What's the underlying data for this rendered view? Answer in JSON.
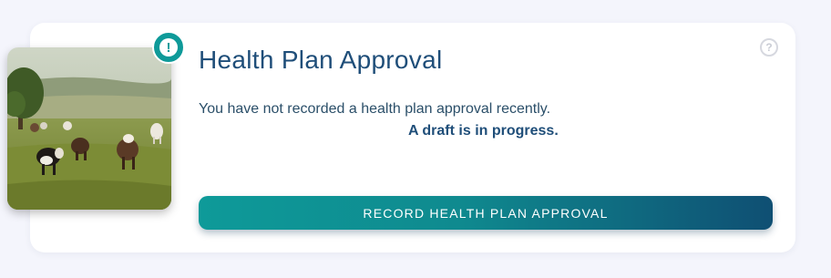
{
  "card": {
    "title": "Health Plan Approval",
    "message": "You have not recorded a health plan approval recently.",
    "draft_status": "A draft is in progress.",
    "record_button_label": "RECORD HEALTH PLAN APPROVAL",
    "alert_glyph": "!",
    "help_glyph": "?"
  },
  "icons": {
    "alert": "exclamation-circle-icon",
    "help": "question-circle-icon"
  },
  "colors": {
    "accent": "#0e9a99",
    "title": "#1f4e79",
    "button_gradient_end": "#0f4f73",
    "background": "#f4f5fc"
  }
}
